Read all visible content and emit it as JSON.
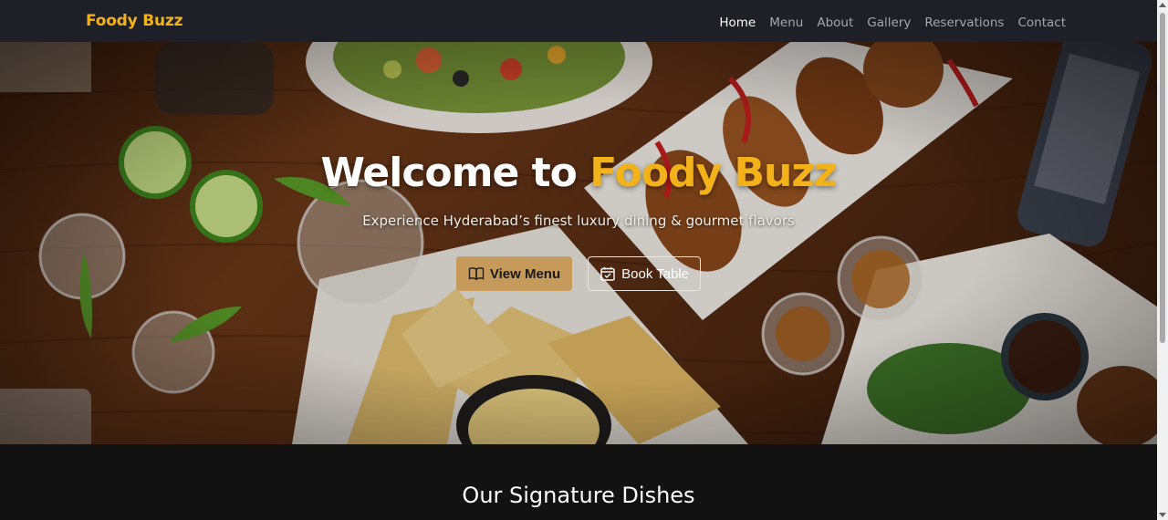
{
  "navbar": {
    "brand": "Foody Buzz",
    "links": [
      {
        "label": "Home",
        "active": true
      },
      {
        "label": "Menu",
        "active": false
      },
      {
        "label": "About",
        "active": false
      },
      {
        "label": "Gallery",
        "active": false
      },
      {
        "label": "Reservations",
        "active": false
      },
      {
        "label": "Contact",
        "active": false
      }
    ]
  },
  "hero": {
    "title_prefix": "Welcome to ",
    "title_accent": "Foody Buzz",
    "subtitle": "Experience Hyderabad’s finest luxury dining & gourmet flavors",
    "primary_button": {
      "label": "View Menu",
      "icon": "book-icon"
    },
    "secondary_button": {
      "label": "Book Table",
      "icon": "calendar-icon"
    }
  },
  "section": {
    "title": "Our Signature Dishes"
  },
  "colors": {
    "accent": "#f4b21a",
    "navbar_bg": "#1f2027",
    "primary_button_bg": "#c59a5a",
    "page_bg": "#121212"
  }
}
